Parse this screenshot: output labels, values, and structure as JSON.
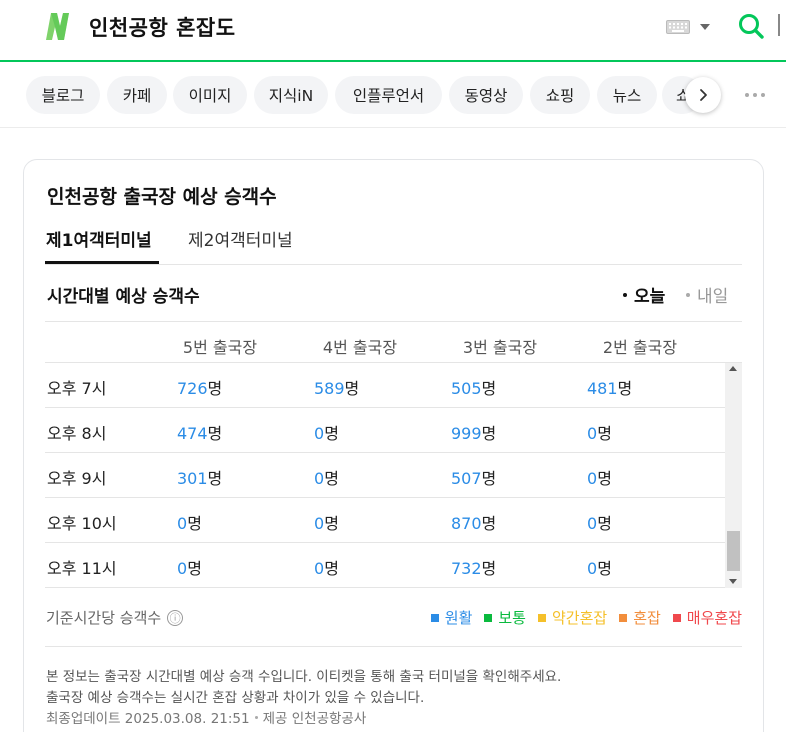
{
  "header": {
    "query": "인천공항 혼잡도",
    "logo_icon": "naver-n-logo-icon",
    "keyboard_icon": "keyboard-icon",
    "search_icon": "search-icon"
  },
  "tabs": [
    "블로그",
    "카페",
    "이미지",
    "지식iN",
    "인플루언서",
    "동영상",
    "쇼핑",
    "뉴스",
    "쇼"
  ],
  "card": {
    "title": "인천공항 출국장 예상 승객수",
    "terminal_tabs": [
      "제1여객터미널",
      "제2여객터미널"
    ],
    "active_terminal": "제1여객터미널",
    "subtitle": "시간대별 예상 승객수",
    "day_options": [
      "오늘",
      "내일"
    ],
    "selected_day": "오늘",
    "columns": [
      "5번 출국장",
      "4번 출국장",
      "3번 출국장",
      "2번 출국장"
    ],
    "unit": "명",
    "rows": [
      {
        "time": "오후 7시",
        "values": [
          "726",
          "589",
          "505",
          "481"
        ]
      },
      {
        "time": "오후 8시",
        "values": [
          "474",
          "0",
          "999",
          "0"
        ]
      },
      {
        "time": "오후 9시",
        "values": [
          "301",
          "0",
          "507",
          "0"
        ]
      },
      {
        "time": "오후 10시",
        "values": [
          "0",
          "0",
          "870",
          "0"
        ]
      },
      {
        "time": "오후 11시",
        "values": [
          "0",
          "0",
          "732",
          "0"
        ]
      }
    ],
    "legend_label": "기준시간당 승객수",
    "info_icon": "ⓘ",
    "legend": [
      {
        "label": "원활",
        "color": "#2b8ce6"
      },
      {
        "label": "보통",
        "color": "#0aba3e"
      },
      {
        "label": "약간혼잡",
        "color": "#f5c02a"
      },
      {
        "label": "혼잡",
        "color": "#f28e3c"
      },
      {
        "label": "매우혼잡",
        "color": "#f0494d"
      }
    ],
    "notes": [
      "본 정보는 출국장 시간대별 예상 승객 수입니다. 이티켓을 통해 출국 터미널을 확인해주세요.",
      "출국장 예상 승객수는 실시간 혼잡 상황과 차이가 있을 수 있습니다."
    ],
    "updated": "최종업데이트 2025.03.08. 21:51",
    "provider": "제공 인천공항공사"
  }
}
